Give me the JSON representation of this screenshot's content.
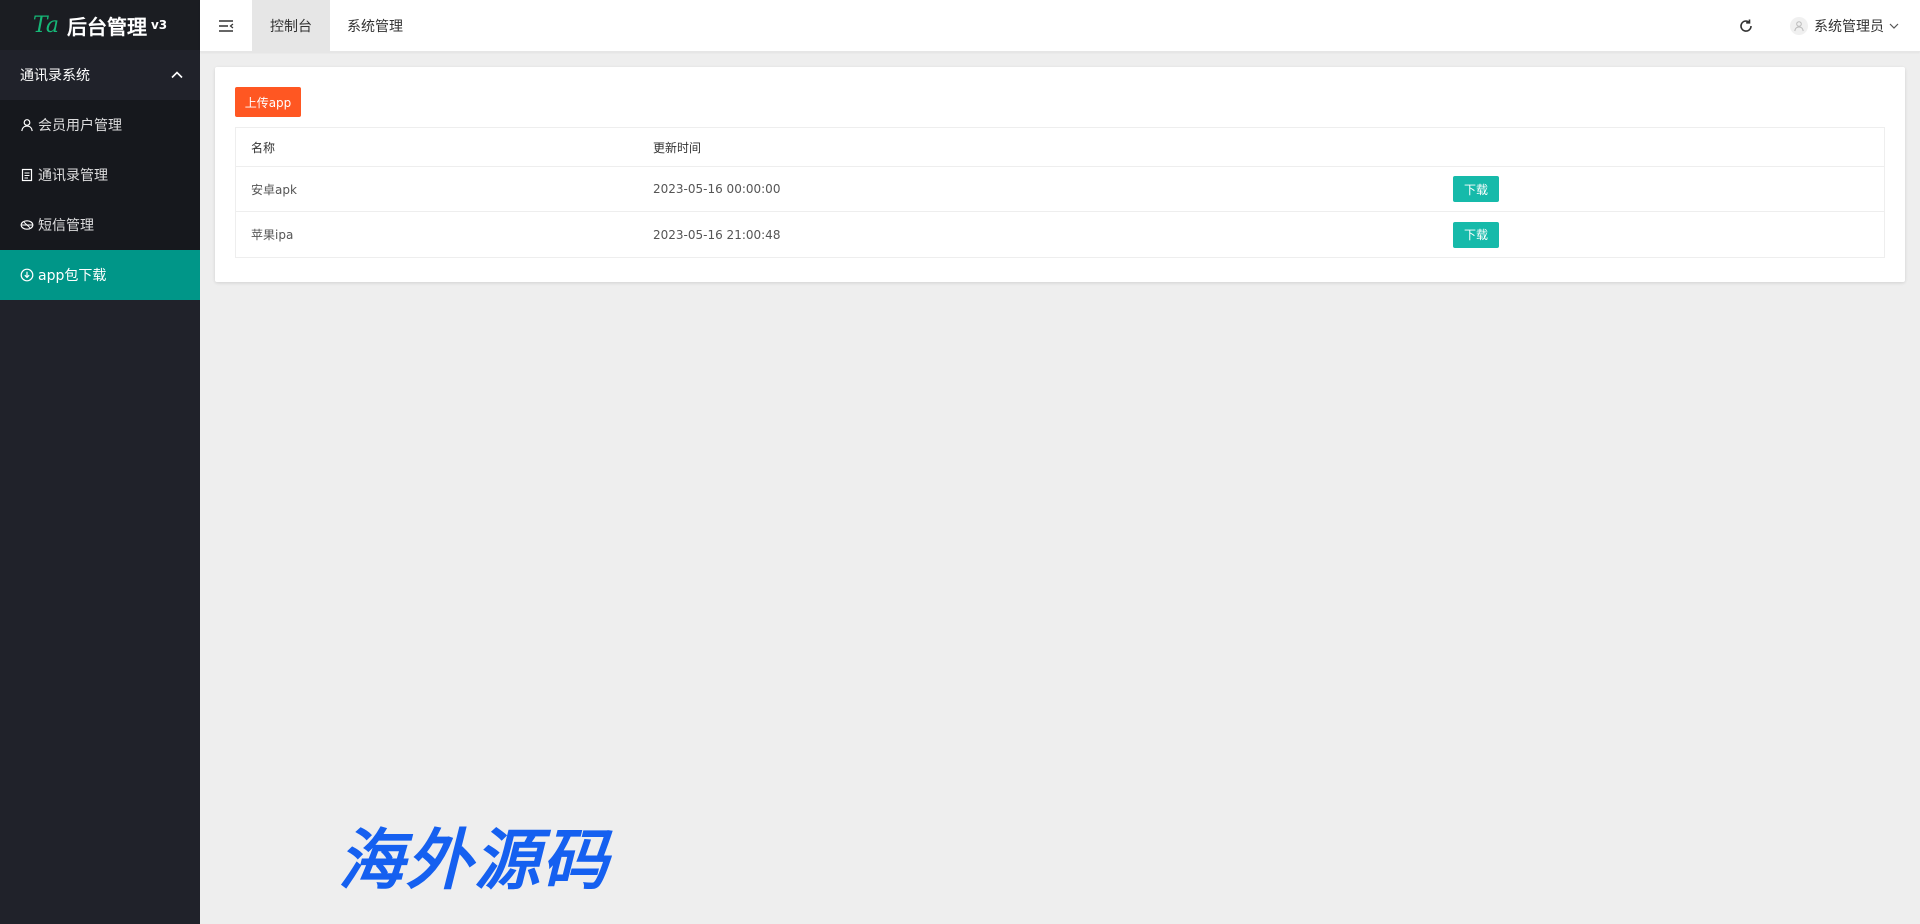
{
  "sidebar": {
    "logo": {
      "mark": "Ta",
      "title": "后台管理",
      "version": "v3"
    },
    "group": {
      "label": "通讯录系统"
    },
    "items": [
      {
        "label": "会员用户管理",
        "icon": "user-icon"
      },
      {
        "label": "通讯录管理",
        "icon": "document-icon"
      },
      {
        "label": "短信管理",
        "icon": "message-icon"
      },
      {
        "label": "app包下载",
        "icon": "download-icon",
        "active": true
      }
    ],
    "active_color": "#009688"
  },
  "header": {
    "tabs": [
      {
        "label": "控制台",
        "active": true
      },
      {
        "label": "系统管理"
      }
    ],
    "user": {
      "name": "系统管理员"
    }
  },
  "main": {
    "upload_button": "上传app",
    "table": {
      "columns": [
        "名称",
        "更新时间",
        ""
      ],
      "rows": [
        {
          "name": "安卓apk",
          "updated": "2023-05-16 00:00:00",
          "action": "下载"
        },
        {
          "name": "苹果ipa",
          "updated": "2023-05-16 21:00:48",
          "action": "下载"
        }
      ]
    }
  },
  "watermark": "海外源码",
  "colors": {
    "upload": "#ff5722",
    "download": "#16baaa",
    "sidebar_bg": "#20222a",
    "watermark": "#1560f0"
  }
}
